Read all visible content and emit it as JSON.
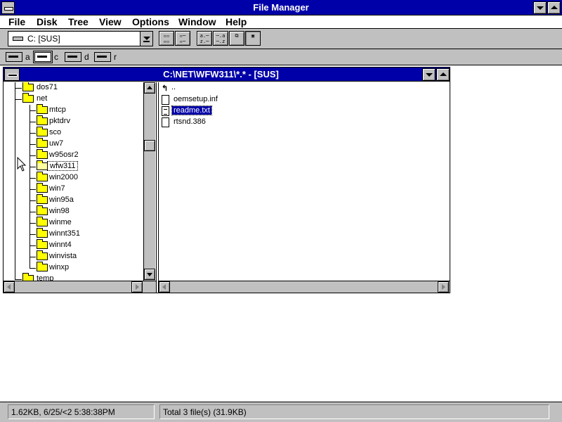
{
  "app": {
    "title": "File Manager"
  },
  "menu": [
    {
      "label": "File"
    },
    {
      "label": "Disk"
    },
    {
      "label": "Tree"
    },
    {
      "label": "View"
    },
    {
      "label": "Options"
    },
    {
      "label": "Window"
    },
    {
      "label": "Help"
    }
  ],
  "toolbar": {
    "drive_select": "C: [SUS]",
    "buttons": [
      {
        "icon": "connect-network-drive-icon"
      },
      {
        "icon": "disconnect-network-drive-icon"
      },
      {
        "icon": "sort-by-name-icon"
      },
      {
        "icon": "sort-by-type-icon"
      },
      {
        "icon": "copy-disk-icon"
      },
      {
        "icon": "properties-icon"
      }
    ]
  },
  "drives": [
    {
      "letter": "a",
      "selected": false
    },
    {
      "letter": "c",
      "selected": true
    },
    {
      "letter": "d",
      "selected": false
    },
    {
      "letter": "r",
      "selected": false
    }
  ],
  "directory_window": {
    "title": "C:\\NET\\WFW311\\*.* - [SUS]",
    "tree": [
      {
        "name": "dos71",
        "level": 1
      },
      {
        "name": "net",
        "level": 1
      },
      {
        "name": "mtcp",
        "level": 2
      },
      {
        "name": "pktdrv",
        "level": 2
      },
      {
        "name": "sco",
        "level": 2
      },
      {
        "name": "uw7",
        "level": 2
      },
      {
        "name": "w95osr2",
        "level": 2
      },
      {
        "name": "wfw311",
        "level": 2,
        "selected": true
      },
      {
        "name": "win2000",
        "level": 2
      },
      {
        "name": "win7",
        "level": 2
      },
      {
        "name": "win95a",
        "level": 2
      },
      {
        "name": "win98",
        "level": 2
      },
      {
        "name": "winme",
        "level": 2
      },
      {
        "name": "winnt351",
        "level": 2
      },
      {
        "name": "winnt4",
        "level": 2
      },
      {
        "name": "winvista",
        "level": 2
      },
      {
        "name": "winxp",
        "level": 2
      },
      {
        "name": "temp",
        "level": 1
      }
    ],
    "files": [
      {
        "name": "..",
        "type": "updir"
      },
      {
        "name": "oemsetup.inf",
        "type": "file",
        "selected": false
      },
      {
        "name": "readme.txt",
        "type": "text",
        "selected": true
      },
      {
        "name": "rtsnd.386",
        "type": "file",
        "selected": false
      }
    ]
  },
  "status": {
    "left": "1.62KB, 6/25/<2 5:38:38PM",
    "right": "Total 3 file(s) (31.9KB)"
  }
}
